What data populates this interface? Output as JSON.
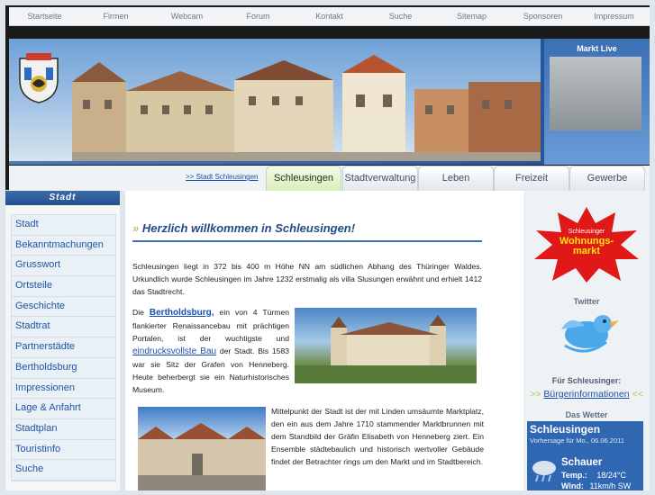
{
  "top_nav": [
    "Startseite",
    "Firmen",
    "Webcam",
    "Forum",
    "Kontakt",
    "Suche",
    "Sitemap",
    "Sponsoren",
    "Impressum"
  ],
  "markt_live": "Markt Live",
  "breadcrumb": ">> Stadt Schleusingen",
  "tabs": [
    "Schleusingen",
    "Stadtverwaltung",
    "Leben",
    "Freizeit",
    "Gewerbe"
  ],
  "left_header": "Stadt",
  "left_menu": [
    "Stadt",
    "Bekanntmachungen",
    "Grusswort",
    "Ortsteile",
    "Geschichte",
    "Stadtrat",
    "Partnerstädte",
    "Bertholdsburg",
    "Impressionen",
    "Lage & Anfahrt",
    "Stadtplan",
    "Touristinfo",
    "Suche"
  ],
  "main": {
    "heading_arrow": "»",
    "heading": "Herzlich willkommen in Schleusingen!",
    "para1": "Schleusingen liegt in 372 bis 400 m Höhe NN am südlichen Abhang des Thüringer Waldes. Urkundlich wurde Schleusingen im Jahre 1232 erstmalig als villa Slusungen erwähnt und erhielt 1412 das Stadtrecht.",
    "para2_prefix": "Die",
    "para2_link1": "Bertholdsburg,",
    "para2_mid": "ein von 4 Türmen flankierter Renaissancebau mit prächtigen Portalen, ist der wuchtigste und",
    "para2_link2": "eindrucksvollste Bau",
    "para2_suffix": "der Stadt. Bis 1583 war sie Sitz der Grafen von Henneberg. Heute beherbergt sie ein Naturhistorisches Museum.",
    "para3": "Mittelpunkt der Stadt ist der mit Linden umsäumte Marktplatz, den ein aus dem Jahre 1710 stammender Marktbrunnen mit dem Standbild der Gräfin Elisabeth von Henneberg ziert. Ein Ensemble städtebaulich und historisch wertvoller Gebäude findet der Betrachter rings um den Markt und im Stadtbereich."
  },
  "right": {
    "badge_top": "Schleusinger",
    "badge_main1": "Wohnungs-",
    "badge_main2": "markt",
    "twitter": "Twitter",
    "fuer": "Für Schleusinger:",
    "buerger_left": ">>",
    "buerger": "Bürgerinformationen",
    "buerger_right": "<<",
    "wetter": "Das Wetter",
    "weather_city": "Schleusingen",
    "weather_sub": "Vorhersage für Mo., 06.06.2011",
    "weather_cond": "Schauer",
    "temp_label": "Temp.:",
    "temp_value": "18/24°C",
    "wind_label": "Wind:",
    "wind_value": "11km/h SW"
  },
  "colors": {
    "accent": "#2f62a8",
    "link": "#1a4fb0",
    "active_tab": "#d8efb8"
  }
}
